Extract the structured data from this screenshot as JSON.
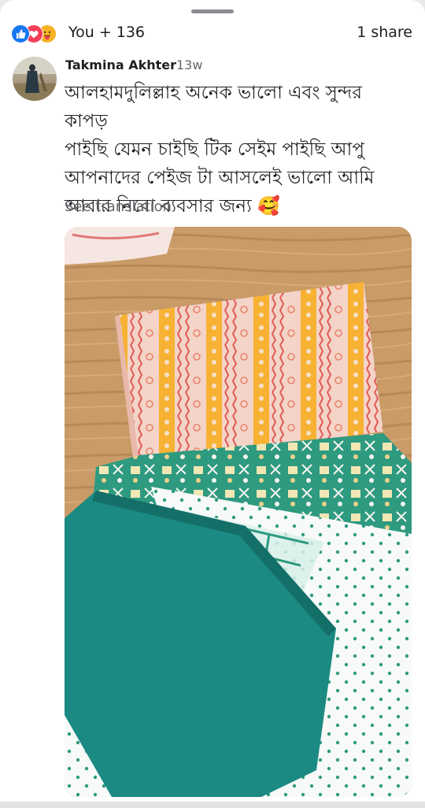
{
  "reactions": {
    "icons": [
      "like-icon",
      "love-icon",
      "care-icon"
    ],
    "count_text": "You + 136",
    "share_text": "1 share"
  },
  "comment": {
    "author": "Takmina Akhter",
    "separator": "·",
    "time": "13w",
    "text": "আলহামদুলিল্লাহ অনেক ভালো এবং সুন্দর কাপড়\nপাইছি যেমন চাইছি টিক সেইম পাইছি আপু\nআপনাদের পেইজ টা আসলেই ভালো আমি\nআবার নিবো ব্যবসার জন্য 🥰",
    "see_translation": "See translation"
  },
  "colors": {
    "like": "#1877f2",
    "love": "#f33e58",
    "care": "#f7b125",
    "secondary_text": "#65676b"
  }
}
